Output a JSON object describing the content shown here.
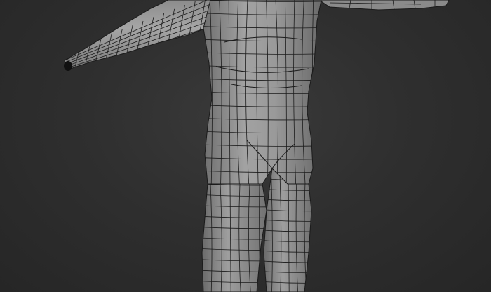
{
  "viewport": {
    "background_color": "#2d2d2d",
    "mesh_fill_color": "#8f8f8f",
    "mesh_shadow_color": "#5a5a5a",
    "wireframe_color": "#1b1b1b"
  },
  "model": {
    "parts": [
      "torso",
      "left-arm",
      "right-arm-stub",
      "pelvis",
      "left-leg",
      "right-leg"
    ]
  }
}
